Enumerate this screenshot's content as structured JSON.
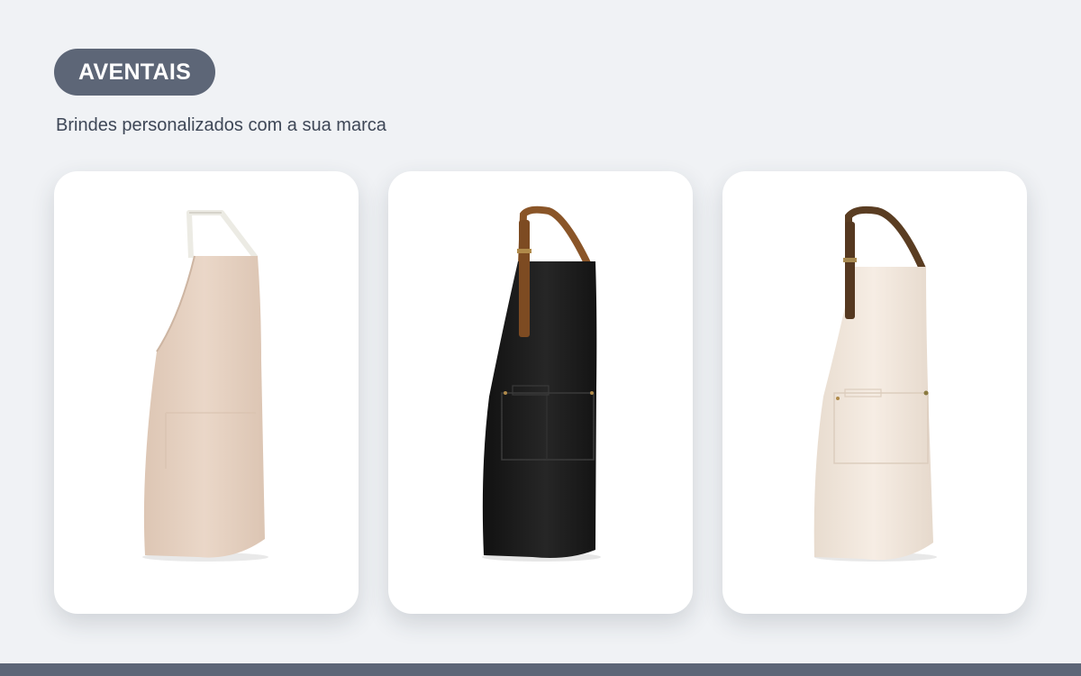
{
  "header": {
    "badge_label": "AVENTAIS",
    "subtitle": "Brindes personalizados com a sua marca"
  },
  "colors": {
    "background": "#f0f2f5",
    "badge": "#5d6677",
    "card": "#ffffff",
    "subtitle_text": "#3e4757"
  },
  "products": [
    {
      "image": "apron-beige-linen-icon",
      "apron_color": "#e6d2c2",
      "strap_color": "#ece9e2"
    },
    {
      "image": "apron-black-leather-strap-icon",
      "apron_color": "#1c1c1c",
      "strap_color": "#8a5528"
    },
    {
      "image": "apron-natural-leather-strap-icon",
      "apron_color": "#f1e6db",
      "strap_color": "#5a3d22"
    }
  ]
}
